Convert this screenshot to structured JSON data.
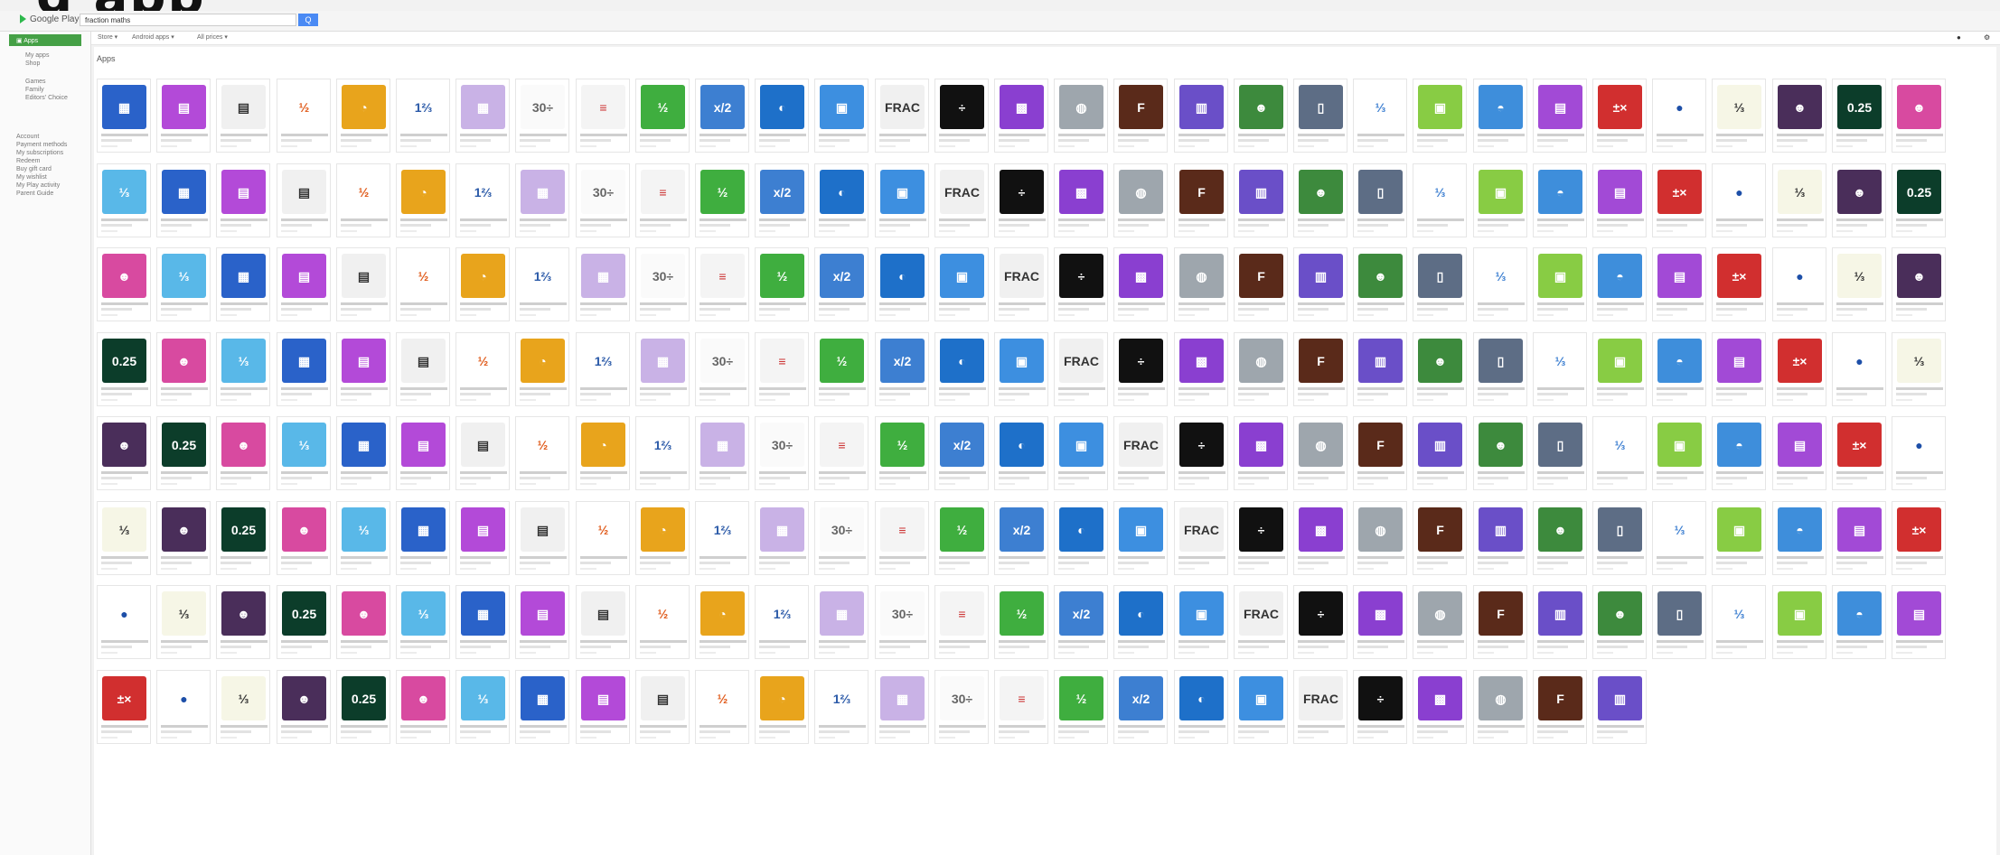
{
  "header": {
    "brand": "Google Play",
    "search_value": "fraction maths",
    "search_button": "Q",
    "caption_partial": "g  app"
  },
  "subbar": {
    "filters": [
      "Store ▾",
      "Android apps ▾",
      "All prices ▾"
    ],
    "icons": [
      "gear-icon",
      "account-icon"
    ]
  },
  "sidebar": {
    "apps_label": "Apps",
    "links": [
      "My apps",
      "Shop",
      "Games",
      "Family",
      "Editors' Choice",
      "Account",
      "Payment methods",
      "My subscriptions",
      "Redeem",
      "Buy gift card",
      "My wishlist",
      "My Play activity",
      "Parent Guide"
    ]
  },
  "main": {
    "section_title": "Apps",
    "rows": 8,
    "cols": 31,
    "last_row_count": 26,
    "tiles": [
      {
        "bg": "#2a62c9",
        "fg": "#fff",
        "t": "▦"
      },
      {
        "bg": "#b34ad8",
        "fg": "#fff",
        "t": "▤"
      },
      {
        "bg": "#f0f0f0",
        "fg": "#333",
        "t": "▤"
      },
      {
        "bg": "#fff",
        "fg": "#e05a1a",
        "t": "½"
      },
      {
        "bg": "#e8a41c",
        "fg": "#fff",
        "t": "◔"
      },
      {
        "bg": "#fff",
        "fg": "#2b5aa8",
        "t": "1⅔"
      },
      {
        "bg": "#c9b2e6",
        "fg": "#fff",
        "t": "▦"
      },
      {
        "bg": "#fafafa",
        "fg": "#666",
        "t": "30÷"
      },
      {
        "bg": "#f4f4f4",
        "fg": "#c33",
        "t": "≡"
      },
      {
        "bg": "#3fae3f",
        "fg": "#fff",
        "t": "½"
      },
      {
        "bg": "#3d7fd1",
        "fg": "#fff",
        "t": "x/2"
      },
      {
        "bg": "#1e70c9",
        "fg": "#fff",
        "t": "◐"
      },
      {
        "bg": "#3d8fe0",
        "fg": "#fff",
        "t": "▣"
      },
      {
        "bg": "#f0f0f0",
        "fg": "#333",
        "t": "FRAC"
      },
      {
        "bg": "#111",
        "fg": "#fff",
        "t": "÷"
      },
      {
        "bg": "#8a3fd0",
        "fg": "#fff",
        "t": "▩"
      },
      {
        "bg": "#9ea6ad",
        "fg": "#fff",
        "t": "◍"
      },
      {
        "bg": "#5a2a1a",
        "fg": "#fff",
        "t": "F"
      },
      {
        "bg": "#6a4fc8",
        "fg": "#fff",
        "t": "▥"
      },
      {
        "bg": "#3d8a3d",
        "fg": "#fff",
        "t": "☻"
      },
      {
        "bg": "#5d6d85",
        "fg": "#fff",
        "t": "▯"
      },
      {
        "bg": "#fff",
        "fg": "#3d7fd1",
        "t": "⅓"
      },
      {
        "bg": "#88cc44",
        "fg": "#fff",
        "t": "▣"
      },
      {
        "bg": "#3e8edb",
        "fg": "#fff",
        "t": "◓"
      },
      {
        "bg": "#a24ad6",
        "fg": "#fff",
        "t": "▤"
      },
      {
        "bg": "#d12f2f",
        "fg": "#fff",
        "t": "±×"
      },
      {
        "bg": "#fff",
        "fg": "#1d4fa8",
        "t": "●"
      },
      {
        "bg": "#f6f6e6",
        "fg": "#333",
        "t": "⅓"
      },
      {
        "bg": "#4a2e5a",
        "fg": "#fff",
        "t": "☻"
      },
      {
        "bg": "#0c3d2a",
        "fg": "#fff",
        "t": "0.25"
      },
      {
        "bg": "#d84aa0",
        "fg": "#fff",
        "t": "☻"
      },
      {
        "bg": "#59b8e8",
        "fg": "#fff",
        "t": "⅓"
      }
    ]
  }
}
